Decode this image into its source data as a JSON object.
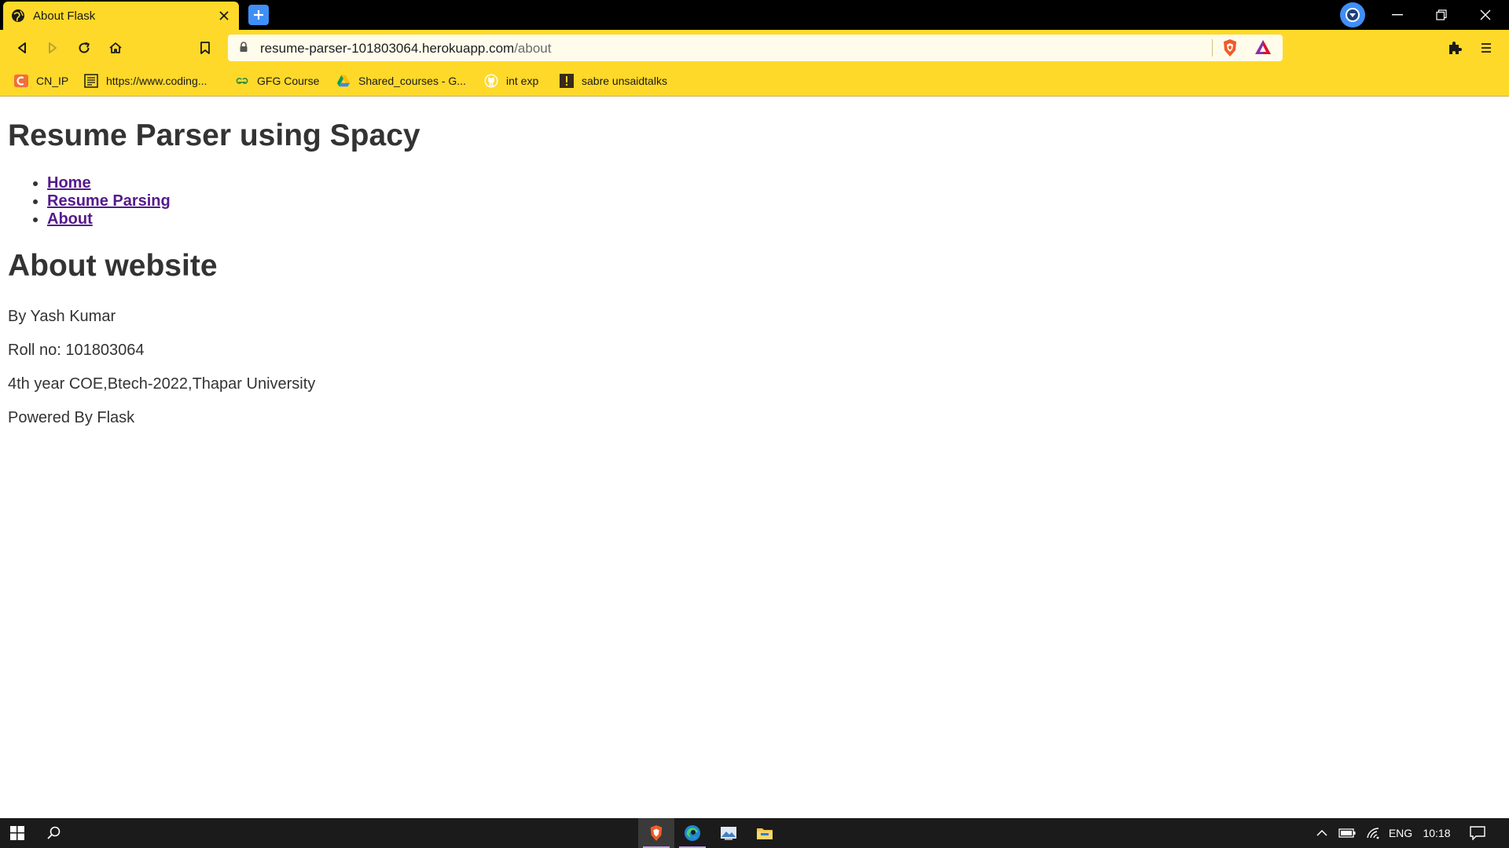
{
  "browser": {
    "tab_title": "About Flask",
    "url_host": "resume-parser-101803064.herokuapp.com",
    "url_path": "/about",
    "accent_color": "#fed929",
    "icons": {
      "tab_favicon": "globe-icon",
      "tab_close": "close-icon",
      "new_tab": "plus-icon",
      "profile": "profile-icon",
      "back": "back-icon",
      "forward": "forward-icon",
      "reload": "reload-icon",
      "home": "home-icon",
      "bookmark": "bookmark-icon",
      "lock": "lock-icon",
      "shields": "brave-shields-icon",
      "rewards": "brave-rewards-icon",
      "extensions": "extensions-icon",
      "menu": "menu-icon"
    }
  },
  "bookmarks": [
    {
      "label": "CN_IP",
      "icon": "cn-icon"
    },
    {
      "label": "https://www.coding...",
      "icon": "page-icon"
    },
    {
      "label": "GFG Course",
      "icon": "gfg-icon"
    },
    {
      "label": "Shared_courses - G...",
      "icon": "drive-icon"
    },
    {
      "label": "int exp",
      "icon": "github-icon"
    },
    {
      "label": "sabre unsaidtalks",
      "icon": "bookmark-site-icon"
    }
  ],
  "page": {
    "heading": "Resume Parser using Spacy",
    "nav": [
      {
        "label": "Home"
      },
      {
        "label": "Resume Parsing"
      },
      {
        "label": "About"
      }
    ],
    "section_heading": "About website",
    "paragraphs": [
      "By Yash Kumar",
      "Roll no: 101803064",
      "4th year COE,Btech-2022,Thapar University",
      "Powered By Flask"
    ]
  },
  "taskbar": {
    "language": "ENG",
    "time": "10:18",
    "apps": [
      "brave-icon",
      "edge-icon",
      "photos-icon",
      "file-explorer-icon"
    ]
  }
}
